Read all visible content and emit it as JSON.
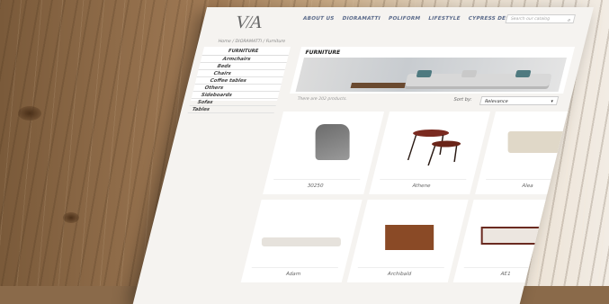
{
  "header": {
    "logo": "V/A",
    "nav": [
      "ABOUT US",
      "DIORAMATTI",
      "POLIFORM",
      "LIFESTYLE",
      "CYPRESS DESIGN"
    ],
    "search_placeholder": "Search our catalog"
  },
  "breadcrumb": "Home / DIORAMATTI / Furniture",
  "sidebar": {
    "heading": "FURNITURE",
    "items": [
      "Armchairs",
      "Beds",
      "Chairs",
      "Coffee tables",
      "Others",
      "Sideboards",
      "Sofas",
      "Tables"
    ]
  },
  "banner": {
    "title": "FURNITURE"
  },
  "listing": {
    "count_text": "There are 202 products.",
    "sort_label": "Sort by:",
    "sort_value": "Relevance"
  },
  "products": [
    "30250",
    "Athene",
    "Alea",
    "Adam",
    "Archibald",
    "AE1"
  ],
  "colors": {
    "nav": "#5a6a8a",
    "accent_teal": "#4f7a80",
    "wood_dark": "#7a5a3a"
  }
}
